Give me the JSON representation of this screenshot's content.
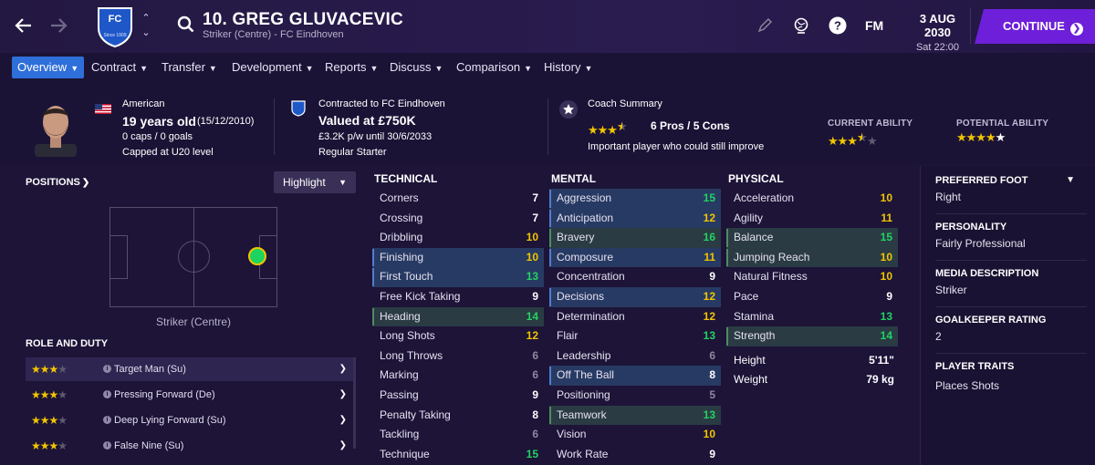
{
  "header": {
    "player_title": "10. GREG GLUVACEVIC",
    "player_subtitle": "Striker (Centre) - FC Eindhoven",
    "club_badge_text": "FC",
    "club_badge_year": "Since 1909",
    "fm_label": "FM",
    "date": "3 AUG 2030",
    "time": "Sat 22:00",
    "continue_label": "CONTINUE",
    "brand_color": "#6e1fd9"
  },
  "tabs": [
    {
      "label": "Overview",
      "active": true
    },
    {
      "label": "Contract"
    },
    {
      "label": "Transfer"
    },
    {
      "label": "Development"
    },
    {
      "label": "Reports"
    },
    {
      "label": "Discuss"
    },
    {
      "label": "Comparison"
    },
    {
      "label": "History"
    }
  ],
  "info": {
    "nationality": "American",
    "age": "19 years old",
    "dob": "(15/12/2010)",
    "caps": "0 caps / 0 goals",
    "capped_level": "Capped at U20 level",
    "contract_label": "Contracted to FC Eindhoven",
    "value": "Valued at £750K",
    "wage": "£3.2K p/w until 30/6/2033",
    "squad_status": "Regular Starter",
    "coach_summary_label": "Coach Summary",
    "coach_stars": 3.5,
    "pros_cons": "6 Pros / 5 Cons",
    "coach_text": "Important player who could still improve",
    "current_ability_label": "CURRENT ABILITY",
    "current_ability_stars": 3.5,
    "potential_ability_label": "POTENTIAL ABILITY",
    "potential_ability_stars": 4.5
  },
  "positions": {
    "title": "POSITIONS",
    "highlight_label": "Highlight",
    "position_label": "Striker (Centre)"
  },
  "roles": {
    "title": "ROLE AND DUTY",
    "items": [
      {
        "name": "Target Man (Su)",
        "stars": 3.5,
        "selected": true
      },
      {
        "name": "Pressing Forward (De)",
        "stars": 3.5
      },
      {
        "name": "Deep Lying Forward (Su)",
        "stars": 3.5
      },
      {
        "name": "False Nine (Su)",
        "stars": 3.5
      }
    ]
  },
  "technical": {
    "title": "TECHNICAL",
    "rows": [
      {
        "name": "Corners",
        "value": "7",
        "hl": ""
      },
      {
        "name": "Crossing",
        "value": "7",
        "hl": ""
      },
      {
        "name": "Dribbling",
        "value": "10",
        "hl": ""
      },
      {
        "name": "Finishing",
        "value": "10",
        "hl": "blue"
      },
      {
        "name": "First Touch",
        "value": "13",
        "hl": "blue"
      },
      {
        "name": "Free Kick Taking",
        "value": "9",
        "hl": ""
      },
      {
        "name": "Heading",
        "value": "14",
        "hl": "green"
      },
      {
        "name": "Long Shots",
        "value": "12",
        "hl": ""
      },
      {
        "name": "Long Throws",
        "value": "6",
        "hl": ""
      },
      {
        "name": "Marking",
        "value": "6",
        "hl": ""
      },
      {
        "name": "Passing",
        "value": "9",
        "hl": ""
      },
      {
        "name": "Penalty Taking",
        "value": "8",
        "hl": ""
      },
      {
        "name": "Tackling",
        "value": "6",
        "hl": ""
      },
      {
        "name": "Technique",
        "value": "15",
        "hl": ""
      }
    ]
  },
  "mental": {
    "title": "MENTAL",
    "rows": [
      {
        "name": "Aggression",
        "value": "15",
        "hl": "blue"
      },
      {
        "name": "Anticipation",
        "value": "12",
        "hl": "blue"
      },
      {
        "name": "Bravery",
        "value": "16",
        "hl": "green"
      },
      {
        "name": "Composure",
        "value": "11",
        "hl": "blue"
      },
      {
        "name": "Concentration",
        "value": "9",
        "hl": ""
      },
      {
        "name": "Decisions",
        "value": "12",
        "hl": "blue"
      },
      {
        "name": "Determination",
        "value": "12",
        "hl": ""
      },
      {
        "name": "Flair",
        "value": "13",
        "hl": ""
      },
      {
        "name": "Leadership",
        "value": "6",
        "hl": ""
      },
      {
        "name": "Off The Ball",
        "value": "8",
        "hl": "blue"
      },
      {
        "name": "Positioning",
        "value": "5",
        "hl": ""
      },
      {
        "name": "Teamwork",
        "value": "13",
        "hl": "green"
      },
      {
        "name": "Vision",
        "value": "10",
        "hl": ""
      },
      {
        "name": "Work Rate",
        "value": "9",
        "hl": ""
      }
    ]
  },
  "physical": {
    "title": "PHYSICAL",
    "rows": [
      {
        "name": "Acceleration",
        "value": "10",
        "hl": ""
      },
      {
        "name": "Agility",
        "value": "11",
        "hl": ""
      },
      {
        "name": "Balance",
        "value": "15",
        "hl": "green"
      },
      {
        "name": "Jumping Reach",
        "value": "10",
        "hl": "green"
      },
      {
        "name": "Natural Fitness",
        "value": "10",
        "hl": ""
      },
      {
        "name": "Pace",
        "value": "9",
        "hl": ""
      },
      {
        "name": "Stamina",
        "value": "13",
        "hl": ""
      },
      {
        "name": "Strength",
        "value": "14",
        "hl": "green"
      }
    ],
    "height_label": "Height",
    "height_value": "5'11\"",
    "weight_label": "Weight",
    "weight_value": "79 kg"
  },
  "details": {
    "preferred_foot_label": "PREFERRED FOOT",
    "preferred_foot": "Right",
    "personality_label": "PERSONALITY",
    "personality": "Fairly Professional",
    "media_label": "MEDIA DESCRIPTION",
    "media": "Striker",
    "gk_label": "GOALKEEPER RATING",
    "gk": "2",
    "traits_label": "PLAYER TRAITS",
    "traits": "Places Shots"
  },
  "icons": [
    "back-arrow-icon",
    "forward-arrow-icon",
    "search-icon",
    "pencil-icon",
    "globe-icon",
    "help-icon",
    "chevron-down-icon",
    "star-icon",
    "info-icon"
  ]
}
